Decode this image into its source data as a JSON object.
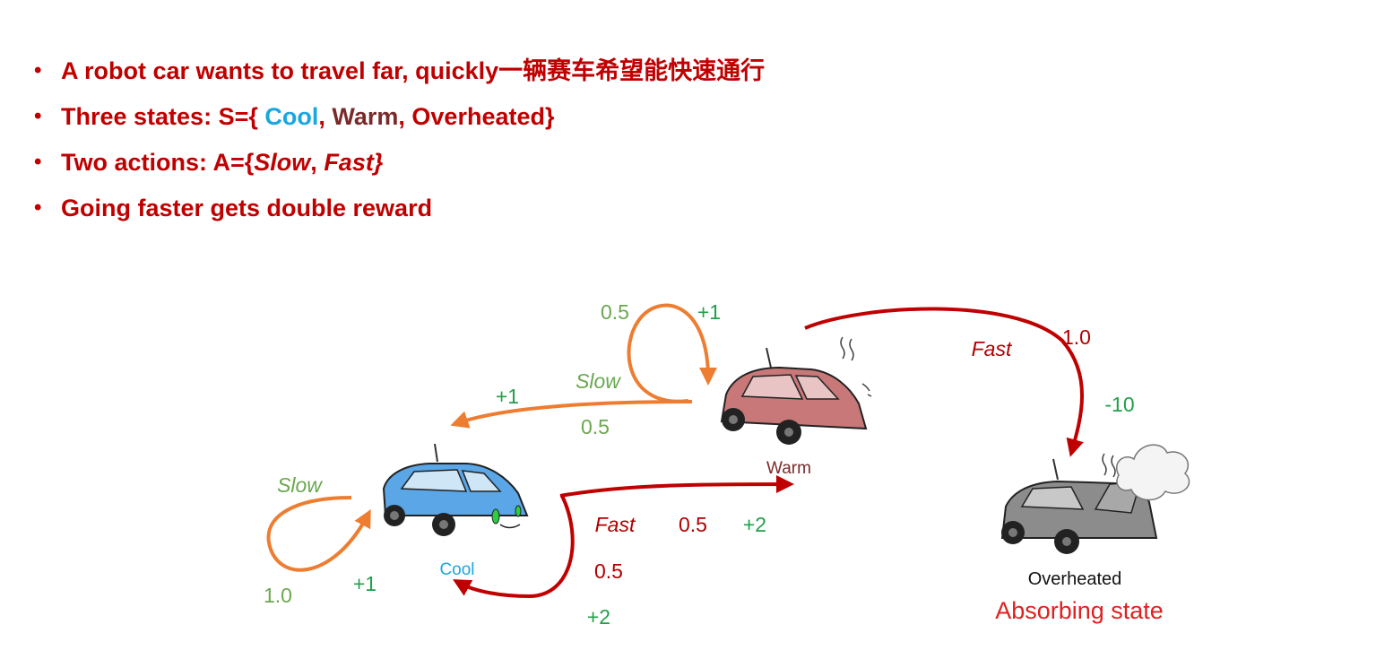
{
  "bullets": {
    "b1": "A robot car wants to travel far, quickly一辆赛车希望能快速通行",
    "b2_prefix": "Three states: S={ ",
    "b2_cool": "Cool",
    "b2_sep1": ", ",
    "b2_warm": "Warm",
    "b2_sep2": ", ",
    "b2_over": "Overheated}",
    "b3_prefix": "Two actions: A={",
    "b3_slow": "Slow",
    "b3_sep": ", ",
    "b3_fast": "Fast}",
    "b4": "Going faster gets double reward"
  },
  "states": {
    "cool": "Cool",
    "warm": "Warm",
    "overheated": "Overheated",
    "absorbing": "Absorbing state"
  },
  "labels": {
    "warm_loop_prob": "0.5",
    "warm_loop_reward": "+1",
    "warm_slow_action": "Slow",
    "warm_to_cool_reward": "+1",
    "warm_to_cool_prob": "0.5",
    "warm_fast_action": "Fast",
    "warm_fast_prob": "1.0",
    "warm_fast_reward": "-10",
    "cool_slow_action": "Slow",
    "cool_slow_prob": "1.0",
    "cool_slow_reward": "+1",
    "cool_fast_action": "Fast",
    "cool_fast_warm_prob": "0.5",
    "cool_fast_warm_reward": "+2",
    "cool_fast_cool_prob": "0.5",
    "cool_fast_cool_reward": "+2"
  },
  "colors": {
    "slow_arrow": "#ed7d31",
    "fast_arrow": "#c00000",
    "cool_car": "#5aa6e6",
    "warm_car": "#c87878",
    "overheated_car": "#8c8c8c"
  }
}
